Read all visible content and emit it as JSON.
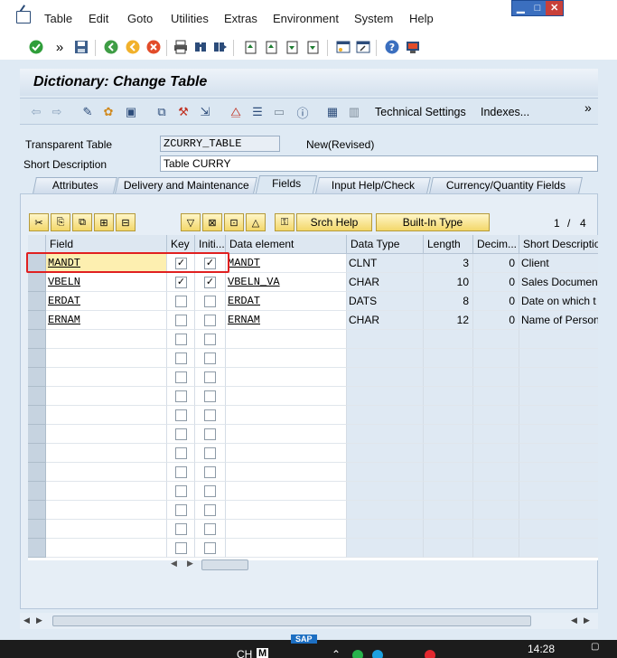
{
  "menu": [
    "Table",
    "Edit",
    "Goto",
    "Utilities",
    "Extras",
    "Environment",
    "System",
    "Help"
  ],
  "window_controls": {
    "minimize": "▁",
    "maximize": "□",
    "close": "✕"
  },
  "title": "Dictionary: Change Table",
  "app_toolbar": {
    "technical_settings": "Technical Settings",
    "indexes": "Indexes...",
    "more": "»"
  },
  "header": {
    "transparent_table_label": "Transparent Table",
    "transparent_table_value": "ZCURRY_TABLE",
    "status": "New(Revised)",
    "short_desc_label": "Short Description",
    "short_desc_value": "Table CURRY"
  },
  "tabs": [
    "Attributes",
    "Delivery and Maintenance",
    "Fields",
    "Input Help/Check",
    "Currency/Quantity Fields"
  ],
  "active_tab": "Fields",
  "table_toolbar": {
    "srch_help": "Srch Help",
    "builtin_type": "Built-In Type",
    "page": "1",
    "page_sep": "/",
    "page_total": "4"
  },
  "columns": [
    "Field",
    "Key",
    "Initi...",
    "Data element",
    "Data Type",
    "Length",
    "Decim...",
    "Short Description"
  ],
  "rows": [
    {
      "field": "MANDT",
      "key": true,
      "init": true,
      "element": "MANDT",
      "type": "CLNT",
      "length": "3",
      "dec": "0",
      "desc": "Client"
    },
    {
      "field": "VBELN",
      "key": true,
      "init": true,
      "element": "VBELN_VA",
      "type": "CHAR",
      "length": "10",
      "dec": "0",
      "desc": "Sales Document"
    },
    {
      "field": "ERDAT",
      "key": false,
      "init": false,
      "element": "ERDAT",
      "type": "DATS",
      "length": "8",
      "dec": "0",
      "desc": "Date on which t"
    },
    {
      "field": "ERNAM",
      "key": false,
      "init": false,
      "element": "ERNAM",
      "type": "CHAR",
      "length": "12",
      "dec": "0",
      "desc": "Name of Person"
    }
  ],
  "empty_rows": 12,
  "taskbar": {
    "lang": "CH",
    "time": "14:28",
    "sap": "SAP"
  }
}
